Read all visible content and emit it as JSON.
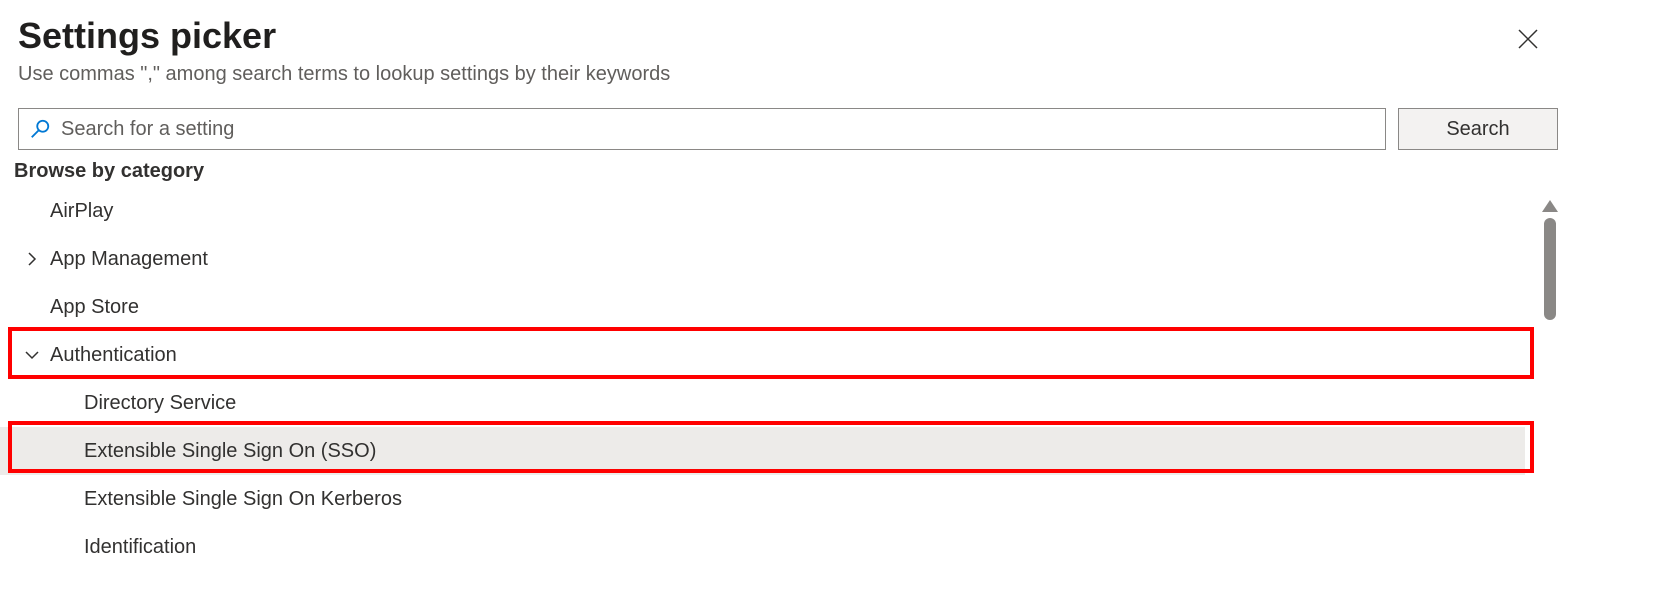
{
  "header": {
    "title": "Settings picker",
    "subtitle": "Use commas \",\" among search terms to lookup settings by their keywords"
  },
  "search": {
    "placeholder": "Search for a setting",
    "button_label": "Search"
  },
  "browse_label": "Browse by category",
  "categories": [
    {
      "label": "AirPlay",
      "expandable": false
    },
    {
      "label": "App Management",
      "expandable": true,
      "expanded": false
    },
    {
      "label": "App Store",
      "expandable": false
    },
    {
      "label": "Authentication",
      "expandable": true,
      "expanded": true,
      "highlighted": true,
      "children": [
        {
          "label": "Directory Service",
          "selected": false
        },
        {
          "label": "Extensible Single Sign On (SSO)",
          "selected": true,
          "highlighted": true
        },
        {
          "label": "Extensible Single Sign On Kerberos",
          "selected": false
        },
        {
          "label": "Identification",
          "selected": false
        }
      ]
    }
  ]
}
